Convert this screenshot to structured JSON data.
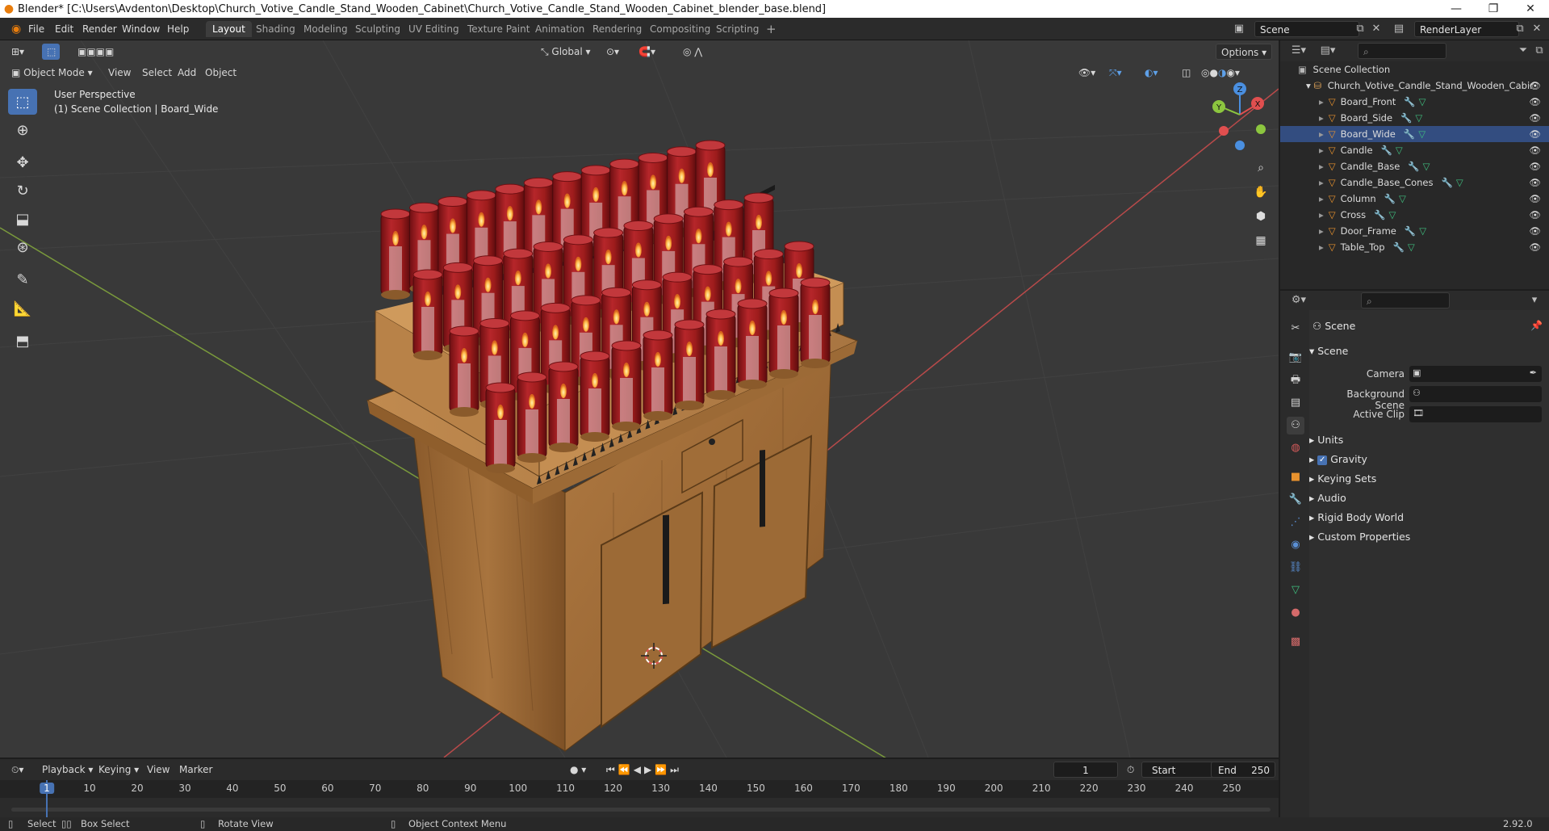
{
  "window": {
    "title": "Blender* [C:\\Users\\Avdenton\\Desktop\\Church_Votive_Candle_Stand_Wooden_Cabinet\\Church_Votive_Candle_Stand_Wooden_Cabinet_blender_base.blend]",
    "controls": [
      "—",
      "❐",
      "✕"
    ]
  },
  "menu": [
    "File",
    "Edit",
    "Render",
    "Window",
    "Help"
  ],
  "workspaces": [
    "Layout",
    "Shading",
    "Modeling",
    "Sculpting",
    "UV Editing",
    "Texture Paint",
    "Animation",
    "Rendering",
    "Compositing",
    "Scripting"
  ],
  "active_workspace": "Layout",
  "scene_name": "Scene",
  "view_layer": "RenderLayer",
  "viewport": {
    "mode": "Object Mode",
    "header_menus": [
      "View",
      "Select",
      "Add",
      "Object"
    ],
    "transform_orientation": "Global",
    "options_label": "Options",
    "overlay_title": "User Perspective",
    "overlay_subtitle": "(1) Scene Collection | Board_Wide",
    "gizmo_axes": [
      "Z",
      "Y",
      "X"
    ]
  },
  "tools": [
    "select-box",
    "cursor",
    "move",
    "rotate",
    "scale",
    "transform",
    "annotate",
    "measure",
    "add-cube"
  ],
  "outliner": {
    "root": "Scene Collection",
    "collection": "Church_Votive_Candle_Stand_Wooden_Cabir",
    "objects": [
      "Board_Front",
      "Board_Side",
      "Board_Wide",
      "Candle",
      "Candle_Base",
      "Candle_Base_Cones",
      "Column",
      "Cross",
      "Door_Frame",
      "Table_Top"
    ],
    "selected": "Board_Wide"
  },
  "properties": {
    "context": "Scene",
    "panel_title": "Scene",
    "fields": [
      {
        "label": "Camera",
        "value": ""
      },
      {
        "label": "Background Scene",
        "value": ""
      },
      {
        "label": "Active Clip",
        "value": ""
      }
    ],
    "subpanels": [
      "Units",
      "Gravity",
      "Keying Sets",
      "Audio",
      "Rigid Body World",
      "Custom Properties"
    ],
    "gravity_checked": true
  },
  "timeline": {
    "menus": [
      "Playback",
      "Keying",
      "View",
      "Marker"
    ],
    "current_frame": "1",
    "start_label": "Start",
    "start": "1",
    "end_label": "End",
    "end": "250",
    "ruler": [
      "1",
      "10",
      "20",
      "30",
      "40",
      "50",
      "60",
      "70",
      "80",
      "90",
      "100",
      "110",
      "120",
      "130",
      "140",
      "150",
      "160",
      "170",
      "180",
      "190",
      "200",
      "210",
      "220",
      "230",
      "240",
      "250"
    ]
  },
  "statusbar": {
    "items": [
      "Select",
      "Box Select",
      "Rotate View",
      "Object Context Menu"
    ],
    "version": "2.92.0"
  },
  "colors": {
    "accent": "#4772b3",
    "wood": "#a8743e",
    "glass": "#9e1c1c",
    "viewport_bg": "#393939",
    "x_axis": "#e04f4f",
    "y_axis": "#8cc63f",
    "z_axis": "#4a8fe0"
  }
}
